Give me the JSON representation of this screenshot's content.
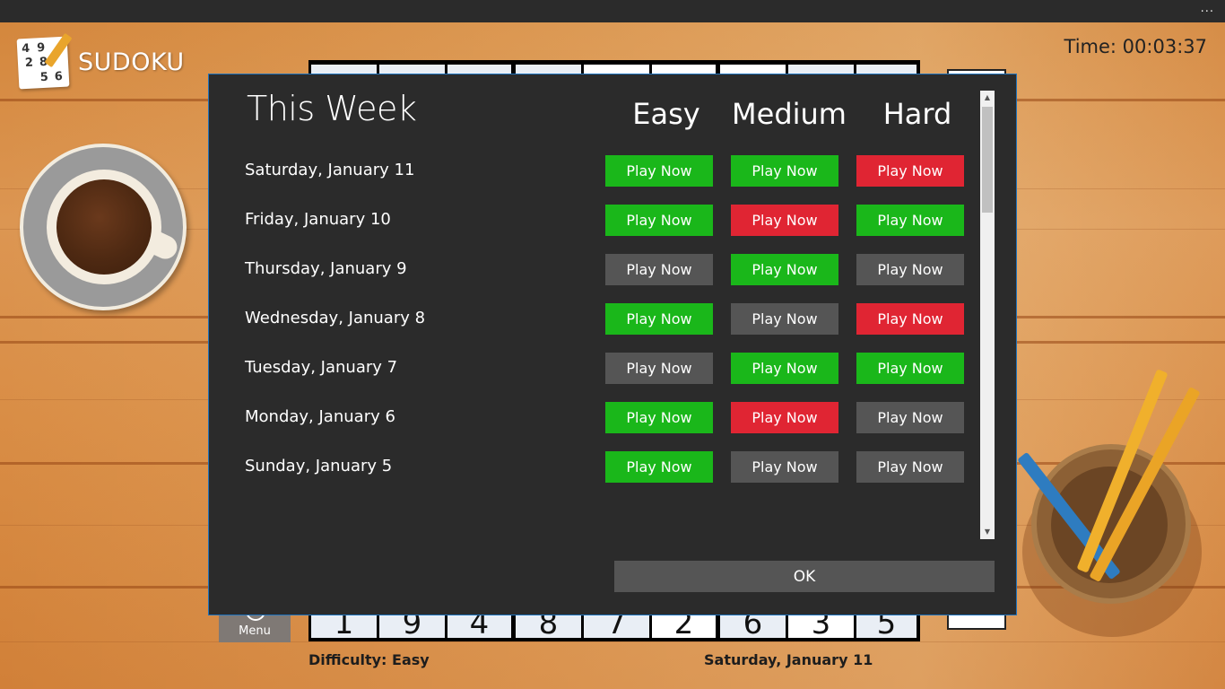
{
  "titlebar": {
    "more_label": "..."
  },
  "app": {
    "logo_text": "SUDOKU",
    "logo_digits": [
      "4",
      "9",
      "2",
      "8",
      "5",
      "6"
    ]
  },
  "timer": {
    "text": "Time: 00:03:37"
  },
  "board": {
    "bottom_row": [
      "1",
      "9",
      "4",
      "8",
      "7",
      "2",
      "6",
      "3",
      "5"
    ]
  },
  "menu": {
    "label": "Menu"
  },
  "footer": {
    "difficulty": "Difficulty: Easy",
    "date": "Saturday, January 11"
  },
  "dialog": {
    "title": "This Week",
    "columns": [
      "Easy",
      "Medium",
      "Hard"
    ],
    "days": [
      {
        "label": "Saturday, January 11",
        "buttons": [
          {
            "text": "Play Now",
            "status": "green"
          },
          {
            "text": "Play Now",
            "status": "green"
          },
          {
            "text": "Play Now",
            "status": "red"
          }
        ]
      },
      {
        "label": "Friday, January 10",
        "buttons": [
          {
            "text": "Play Now",
            "status": "green"
          },
          {
            "text": "Play Now",
            "status": "red"
          },
          {
            "text": "Play Now",
            "status": "green"
          }
        ]
      },
      {
        "label": "Thursday, January 9",
        "buttons": [
          {
            "text": "Play Now",
            "status": "gray"
          },
          {
            "text": "Play Now",
            "status": "green"
          },
          {
            "text": "Play Now",
            "status": "gray"
          }
        ]
      },
      {
        "label": "Wednesday, January 8",
        "buttons": [
          {
            "text": "Play Now",
            "status": "green"
          },
          {
            "text": "Play Now",
            "status": "gray"
          },
          {
            "text": "Play Now",
            "status": "red"
          }
        ]
      },
      {
        "label": "Tuesday, January 7",
        "buttons": [
          {
            "text": "Play Now",
            "status": "gray"
          },
          {
            "text": "Play Now",
            "status": "green"
          },
          {
            "text": "Play Now",
            "status": "green"
          }
        ]
      },
      {
        "label": "Monday, January 6",
        "buttons": [
          {
            "text": "Play Now",
            "status": "green"
          },
          {
            "text": "Play Now",
            "status": "red"
          },
          {
            "text": "Play Now",
            "status": "gray"
          }
        ]
      },
      {
        "label": "Sunday, January 5",
        "buttons": [
          {
            "text": "Play Now",
            "status": "green"
          },
          {
            "text": "Play Now",
            "status": "gray"
          },
          {
            "text": "Play Now",
            "status": "gray"
          }
        ]
      }
    ],
    "ok_label": "OK"
  },
  "colors": {
    "green": "#1ab71a",
    "red": "#e02533",
    "gray": "#555555",
    "dialog_bg": "#2b2b2b",
    "dialog_border": "#1e73be"
  }
}
